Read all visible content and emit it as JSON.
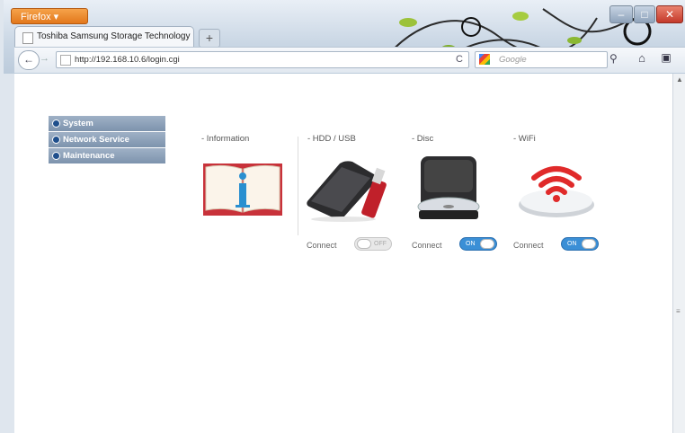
{
  "browser": {
    "app_button": "Firefox",
    "tab_title": "Toshiba Samsung Storage Technology",
    "new_tab": "+",
    "url": "http://192.168.10.6/login.cgi",
    "search_placeholder": "Google",
    "window_controls": {
      "minimize": "–",
      "maximize": "□",
      "close": "✕"
    },
    "nav": {
      "back": "←",
      "forward": "→",
      "reload": "C",
      "search_go": "⚲",
      "home": "⌂",
      "addon": "▣"
    }
  },
  "sidebar": {
    "items": [
      {
        "label": "System"
      },
      {
        "label": "Network Service"
      },
      {
        "label": "Maintenance"
      }
    ]
  },
  "sections": {
    "information": {
      "title": "- Information"
    },
    "hdd": {
      "title": "- HDD / USB",
      "connect_label": "Connect",
      "toggle_text": "OFF",
      "state": "off"
    },
    "disc": {
      "title": "- Disc",
      "connect_label": "Connect",
      "toggle_text": "ON",
      "state": "on"
    },
    "wifi": {
      "title": "- WiFi",
      "connect_label": "Connect",
      "toggle_text": "ON",
      "state": "on"
    }
  },
  "colors": {
    "accent_blue": "#3b8fd6",
    "menu_bg": "#8ea3bc",
    "wifi_red": "#e02a2a",
    "firefox_orange": "#e8862c"
  }
}
